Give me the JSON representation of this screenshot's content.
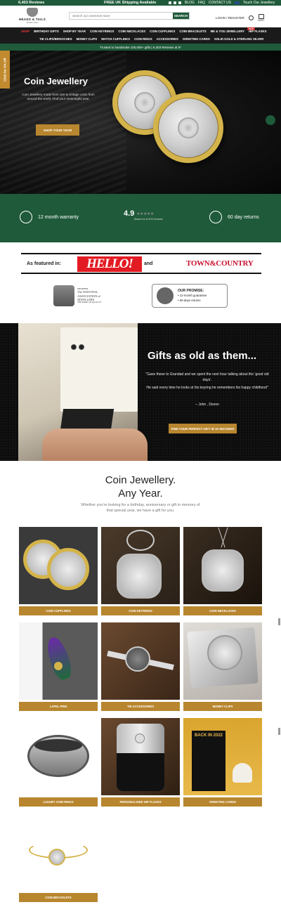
{
  "topbar": {
    "reviews": "6,403 Reviews",
    "shipping": "FREE UK Shipping Available",
    "links": [
      "BLOG",
      "FAQ",
      "CONTACT US"
    ],
    "touch": "Touch Our Jewellery"
  },
  "header": {
    "logo_title": "HEADS & TAILS",
    "logo_sub": "JEWELLERY",
    "search_placeholder": "Search our extensive store",
    "search_button": "SEARCH",
    "login": "LOGIN / REGISTER",
    "cart": "CART"
  },
  "nav": {
    "row1": [
      "SHOP",
      "BIRTHDAY GIFTS",
      "SHOP BY YEAR",
      "COIN KEYRINGS",
      "COIN NECKLACES",
      "COIN CUFFLINKS",
      "COIN BRACELETS",
      "ME & YOU JEWELLERY",
      "HIP FLASKS"
    ],
    "row2": [
      "TIE CLIPS/BROOCHES",
      "MONEY CLIPS",
      "WATCH CUFFLINKS",
      "COIN RINGS",
      "ACCESSORIES",
      "GREETING CARDS",
      "SOLID GOLD & STERLING SILVER"
    ],
    "new_badge": "NEW"
  },
  "trust_bar": "Trusted to handmake 100,000+ gifts | 6,403 Reviews at 5*",
  "side_tab": "Click for 5% Off",
  "hero": {
    "title": "Coin Jewellery",
    "text": "Coin Jewellery made from rare & vintage coins from around the world. Find your meaningful year.",
    "cta": "SHOP YOUR YEAR"
  },
  "features": {
    "warranty": "12 month warranty",
    "rating": "4.9",
    "stars": "★★★★★",
    "rating_sub": "Based on 6,403 reviews",
    "returns": "60 day returns"
  },
  "as_featured": {
    "label": "As featured in:",
    "hello": "HELLO!",
    "and": "and",
    "tc": "TOWN&COUNTRY"
  },
  "association": {
    "member": "MEMBER",
    "line1": "The NATIONAL",
    "line2": "ASSOCIATION of",
    "line3": "JEWELLERS",
    "line4": "THE MARK OF QUALITY"
  },
  "promise": {
    "title": "OUR PROMISE:",
    "item1": "• 12-month guarantee",
    "item2": "• 60-days returns"
  },
  "gifts": {
    "title": "Gifts as old as them...",
    "quote1": "\"Gave these to Grandad and we spent the next hour talking about the 'good old days'.",
    "quote2": "He said every time he looks at his keyring he remembers his happy childhood\"",
    "author": "– John , Devon",
    "cta": "FIND YOUR PERFECT GIFT IN 15 SECONDS"
  },
  "collection": {
    "title1": "Coin Jewellery.",
    "title2": "Any Year.",
    "subtitle": "Whether you're looking for a birthday, anniversary or gift in memory of that special year, we have a gift for you.",
    "tiles": [
      "COIN CUFFLINKS",
      "COIN KEYRINGS",
      "COIN NECKLACES",
      "LAPEL PINS",
      "TIE ACCESSORIES",
      "MONEY CLIPS",
      "LUXURY COIN RINGS",
      "PERSONALISED HIP FLASKS",
      "GREETING CARDS",
      "COIN BRACELETS"
    ],
    "card_text": "BACK IN 2022"
  },
  "colors": {
    "green": "#1f5a3a",
    "gold": "#b8862f",
    "dark": "#1a1a1a"
  }
}
